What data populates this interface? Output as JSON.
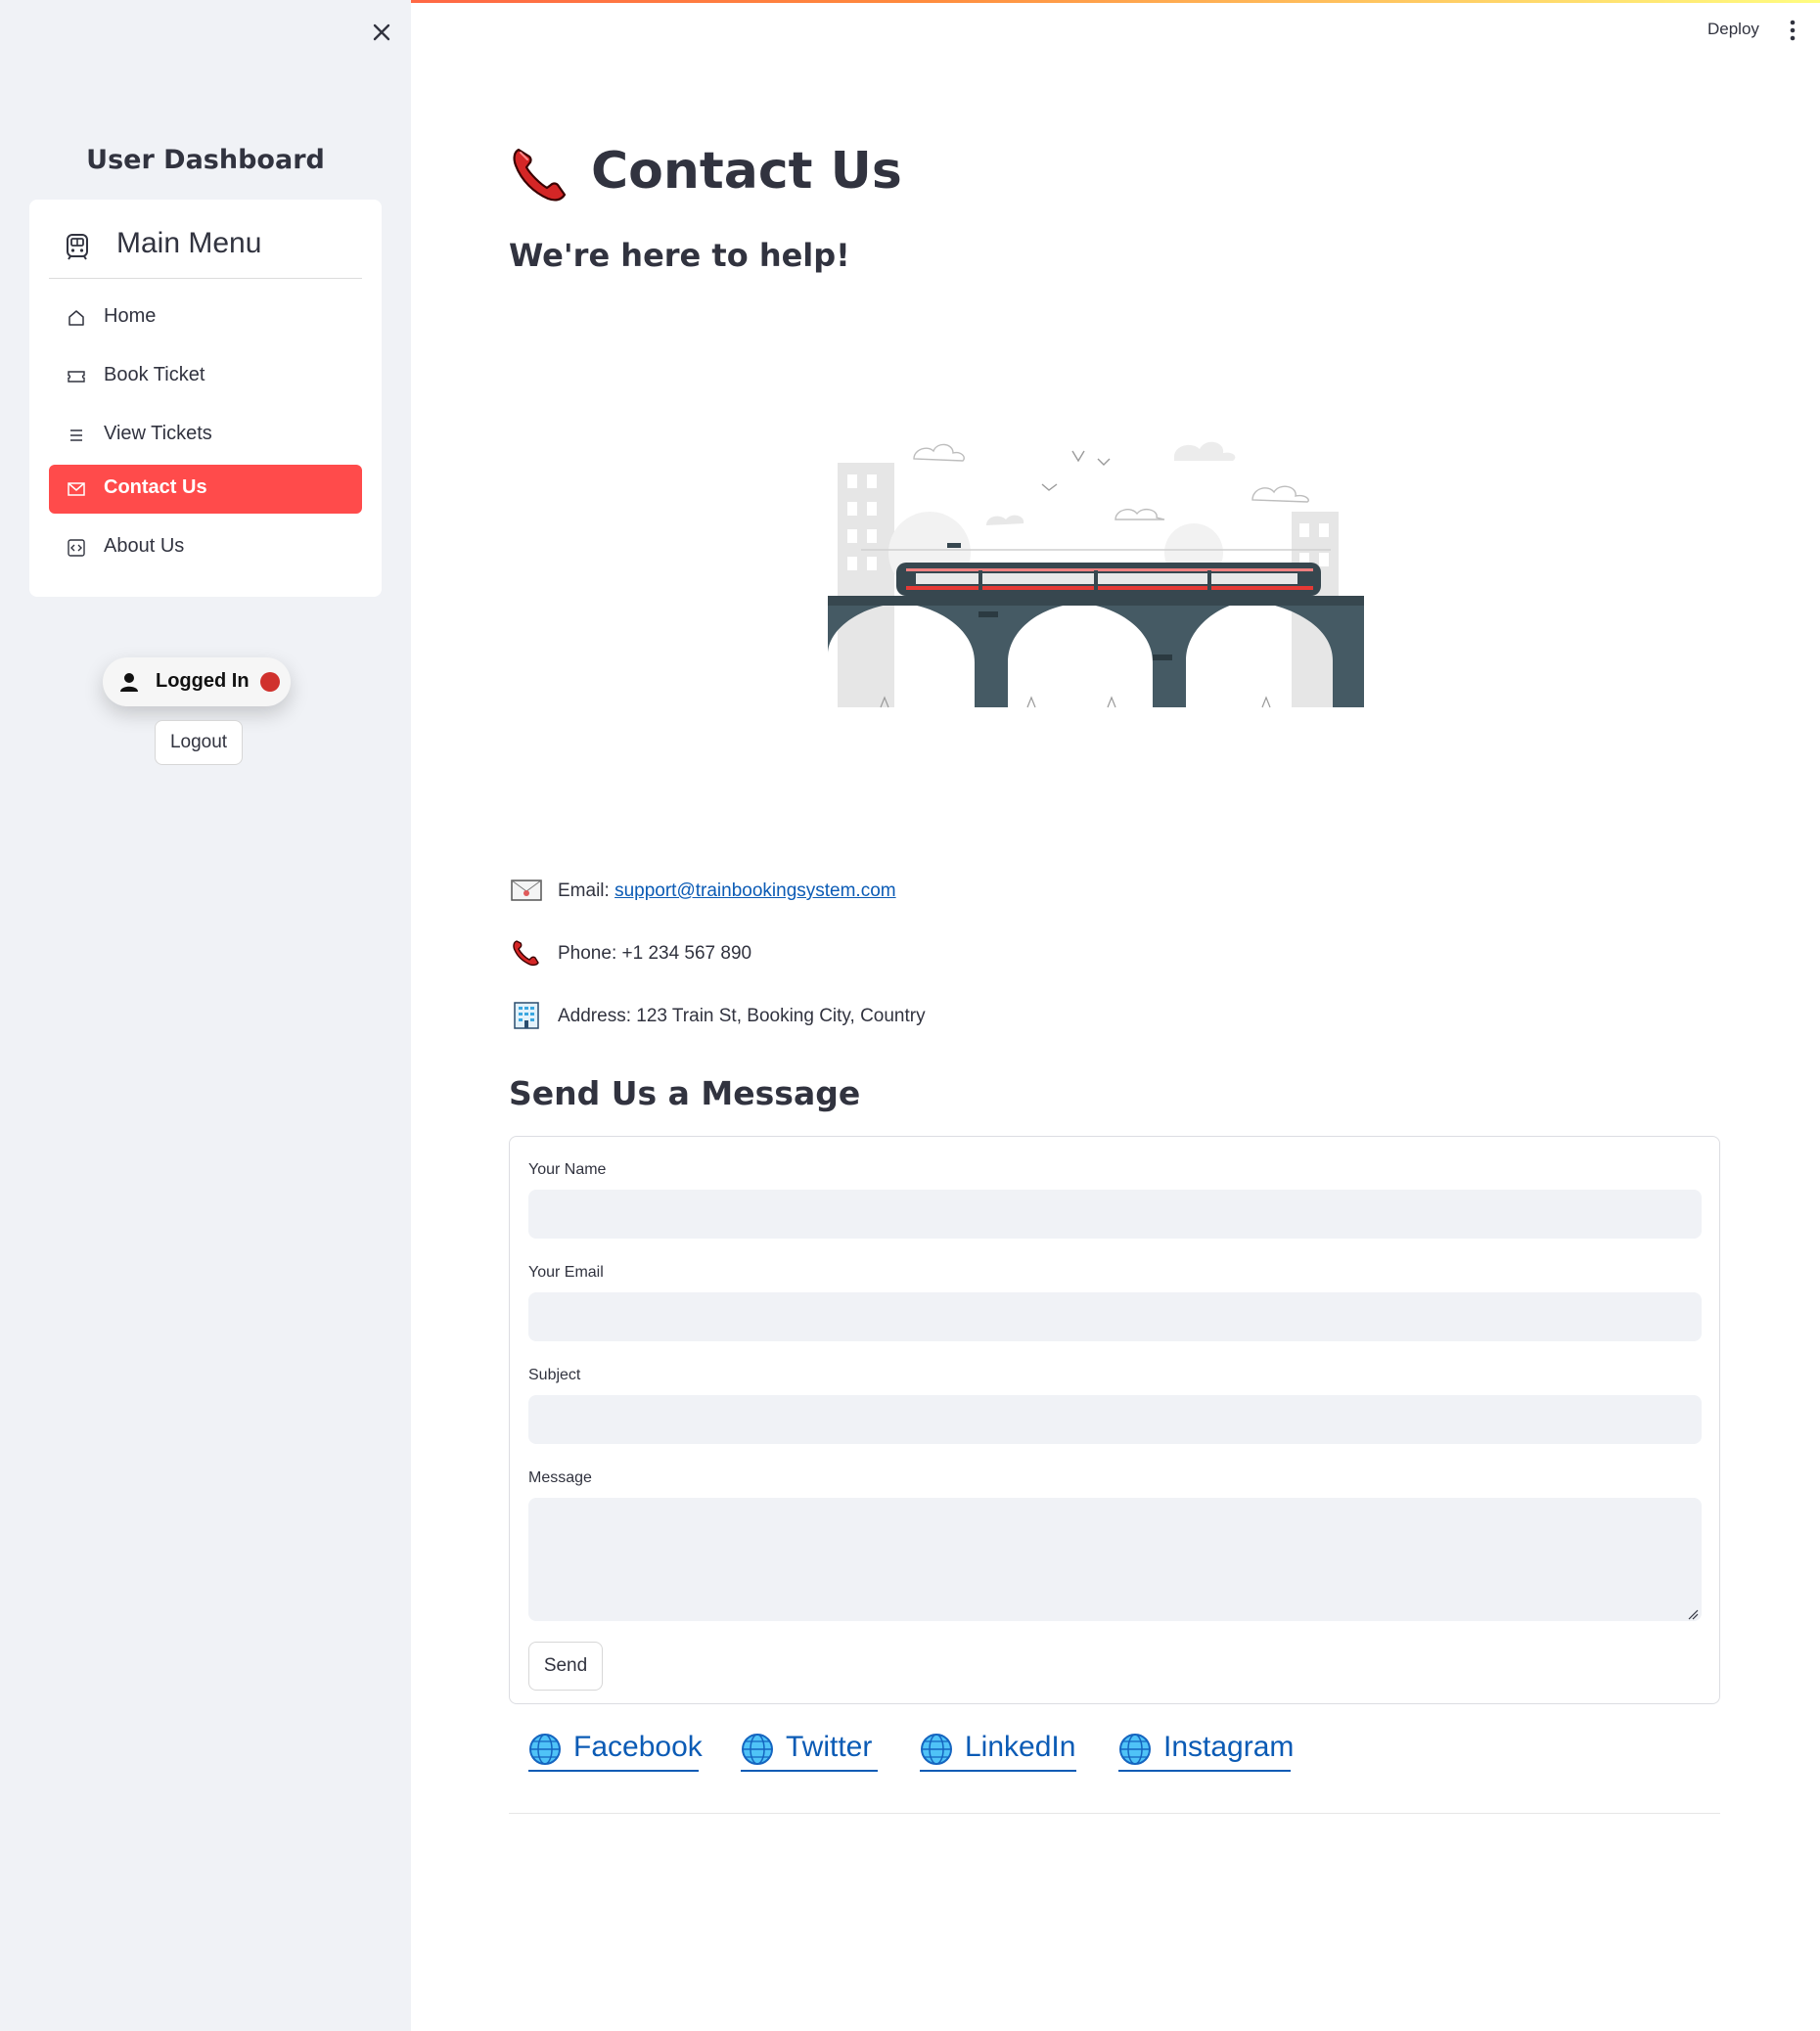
{
  "header": {
    "deploy_label": "Deploy"
  },
  "sidebar": {
    "title": "User Dashboard",
    "menu_title": "Main Menu",
    "items": [
      {
        "label": "Home",
        "icon": "house-icon",
        "active": false
      },
      {
        "label": "Book Ticket",
        "icon": "ticket-icon",
        "active": false
      },
      {
        "label": "View Tickets",
        "icon": "list-icon",
        "active": false
      },
      {
        "label": "Contact Us",
        "icon": "envelope-icon",
        "active": true
      },
      {
        "label": "About Us",
        "icon": "code-square-icon",
        "active": false
      }
    ],
    "status_label": "Logged In",
    "logout_label": "Logout",
    "accent_color": "#ff4b4b",
    "status_dot_color": "#d0312d"
  },
  "main": {
    "title": "Contact Us",
    "subtitle": "We're here to help!",
    "contact": {
      "email_label": "Email: ",
      "email_value": "support@trainbookingsystem.com",
      "phone_text": "Phone: +1 234 567 890",
      "address_text": "Address: 123 Train St, Booking City, Country"
    },
    "form": {
      "section_title": "Send Us a Message",
      "name_label": "Your Name",
      "name_value": "",
      "email_label": "Your Email",
      "email_value": "",
      "subject_label": "Subject",
      "subject_value": "",
      "message_label": "Message",
      "message_value": "",
      "send_label": "Send"
    },
    "social": [
      {
        "label": "Facebook",
        "icon": "globe-icon"
      },
      {
        "label": "Twitter",
        "icon": "globe-icon"
      },
      {
        "label": "LinkedIn",
        "icon": "globe-icon"
      },
      {
        "label": "Instagram",
        "icon": "globe-icon"
      }
    ],
    "link_color": "#0b5bb5"
  }
}
